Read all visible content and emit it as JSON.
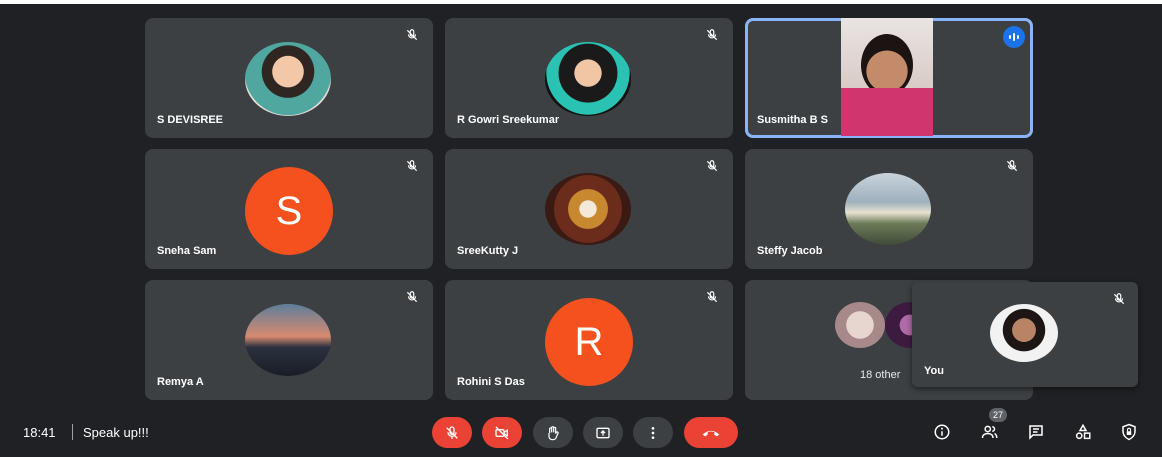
{
  "participants": [
    {
      "name": "S DEVISREE"
    },
    {
      "name": "R Gowri Sreekumar"
    },
    {
      "name": "Susmitha B S"
    },
    {
      "name": "Sneha Sam",
      "initial": "S",
      "color": "#f4511e"
    },
    {
      "name": "SreeKutty J"
    },
    {
      "name": "Steffy Jacob"
    },
    {
      "name": "Remya A"
    },
    {
      "name": "Rohini S Das",
      "initial": "R",
      "color": "#f4511e"
    }
  ],
  "others_label": "18 other",
  "self_label": "You",
  "bottom_bar": {
    "time": "18:41",
    "meeting_name": "Speak up!!!",
    "participant_count": "27"
  },
  "colors": {
    "background": "#202124",
    "tile": "#3c4043",
    "danger": "#ea4335",
    "speaking": "#1a73e8",
    "active_outline": "#8ab4f8"
  },
  "icons": [
    "mic-off-icon",
    "video-off-icon",
    "raise-hand-icon",
    "present-icon",
    "more-options-icon",
    "end-call-icon",
    "info-icon",
    "people-icon",
    "chat-icon",
    "activities-icon",
    "host-controls-icon",
    "speaking-indicator-icon"
  ]
}
